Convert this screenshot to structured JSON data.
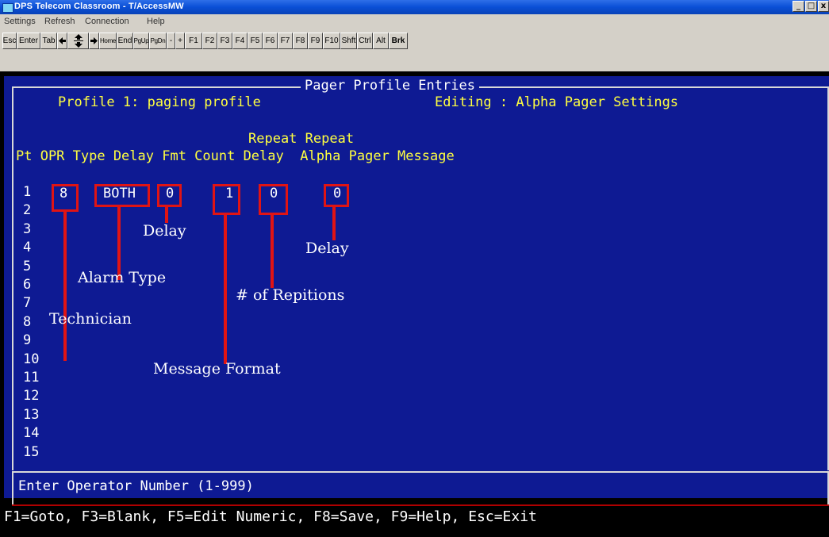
{
  "window": {
    "title": "DPS Telecom Classroom - T/AccessMW",
    "minimize": "_",
    "maximize": "□",
    "close": "x"
  },
  "menu": [
    "Settings",
    "Refresh",
    "Connection",
    "Help"
  ],
  "keys": [
    {
      "label": "Esc",
      "w": 18
    },
    {
      "label": "Enter",
      "w": 30
    },
    {
      "label": "Tab",
      "w": 21
    },
    {
      "label": "left-arrow-icon",
      "icon": true,
      "w": 13
    },
    {
      "label": "updown-arrow-icon",
      "icon": true,
      "w": 27
    },
    {
      "label": "right-arrow-icon",
      "icon": true,
      "w": 13
    },
    {
      "label": "Home",
      "w": 22,
      "narrow": true
    },
    {
      "label": "End",
      "w": 21
    },
    {
      "label": "PgUp",
      "w": 20,
      "narrow": true
    },
    {
      "label": "PgDn",
      "w": 22,
      "narrow": true
    },
    {
      "label": "-",
      "w": 11
    },
    {
      "label": "+",
      "w": 12
    },
    {
      "label": "F1",
      "w": 22
    },
    {
      "label": "F2",
      "w": 19
    },
    {
      "label": "F3",
      "w": 19
    },
    {
      "label": "F4",
      "w": 19
    },
    {
      "label": "F5",
      "w": 19
    },
    {
      "label": "F6",
      "w": 19
    },
    {
      "label": "F7",
      "w": 19
    },
    {
      "label": "F8",
      "w": 19
    },
    {
      "label": "F9",
      "w": 19
    },
    {
      "label": "F10",
      "w": 22
    },
    {
      "label": "Shft",
      "w": 21
    },
    {
      "label": "Ctrl",
      "w": 20
    },
    {
      "label": "Alt",
      "w": 20
    },
    {
      "label": "Brk",
      "w": 24,
      "bold": true
    }
  ],
  "screen": {
    "frame_title": "Pager Profile Entries",
    "profile_label": "Profile 1: paging profile",
    "editing_label": "Editing : Alpha Pager Settings",
    "header_line1": "Repeat Repeat",
    "header_line2": "Pt OPR Type Delay Fmt Count Delay  Alpha Pager Message",
    "rows": [
      "1",
      "2",
      "3",
      "4",
      "5",
      "6",
      "7",
      "8",
      "9",
      "10",
      "11",
      "12",
      "13",
      "14",
      "15"
    ],
    "row1": {
      "opr": "8",
      "type": "BOTH",
      "delay": "0",
      "fmt": "1",
      "count": "0",
      "repeat_delay": "0"
    },
    "prompt": "Enter Operator Number (1-999)",
    "function_keys": "F1=Goto, F3=Blank, F5=Edit Numeric, F8=Save, F9=Help, Esc=Exit"
  },
  "annotations": {
    "technician": "Technician",
    "alarm_type": "Alarm Type",
    "delay": "Delay",
    "message_format": "Message Format",
    "repetitions": "# of Repitions",
    "repeat_delay": "Delay"
  },
  "colors": {
    "terminal_bg": "#0e1a93",
    "label_yellow": "#ffff40",
    "annotation_red": "#e01414"
  }
}
